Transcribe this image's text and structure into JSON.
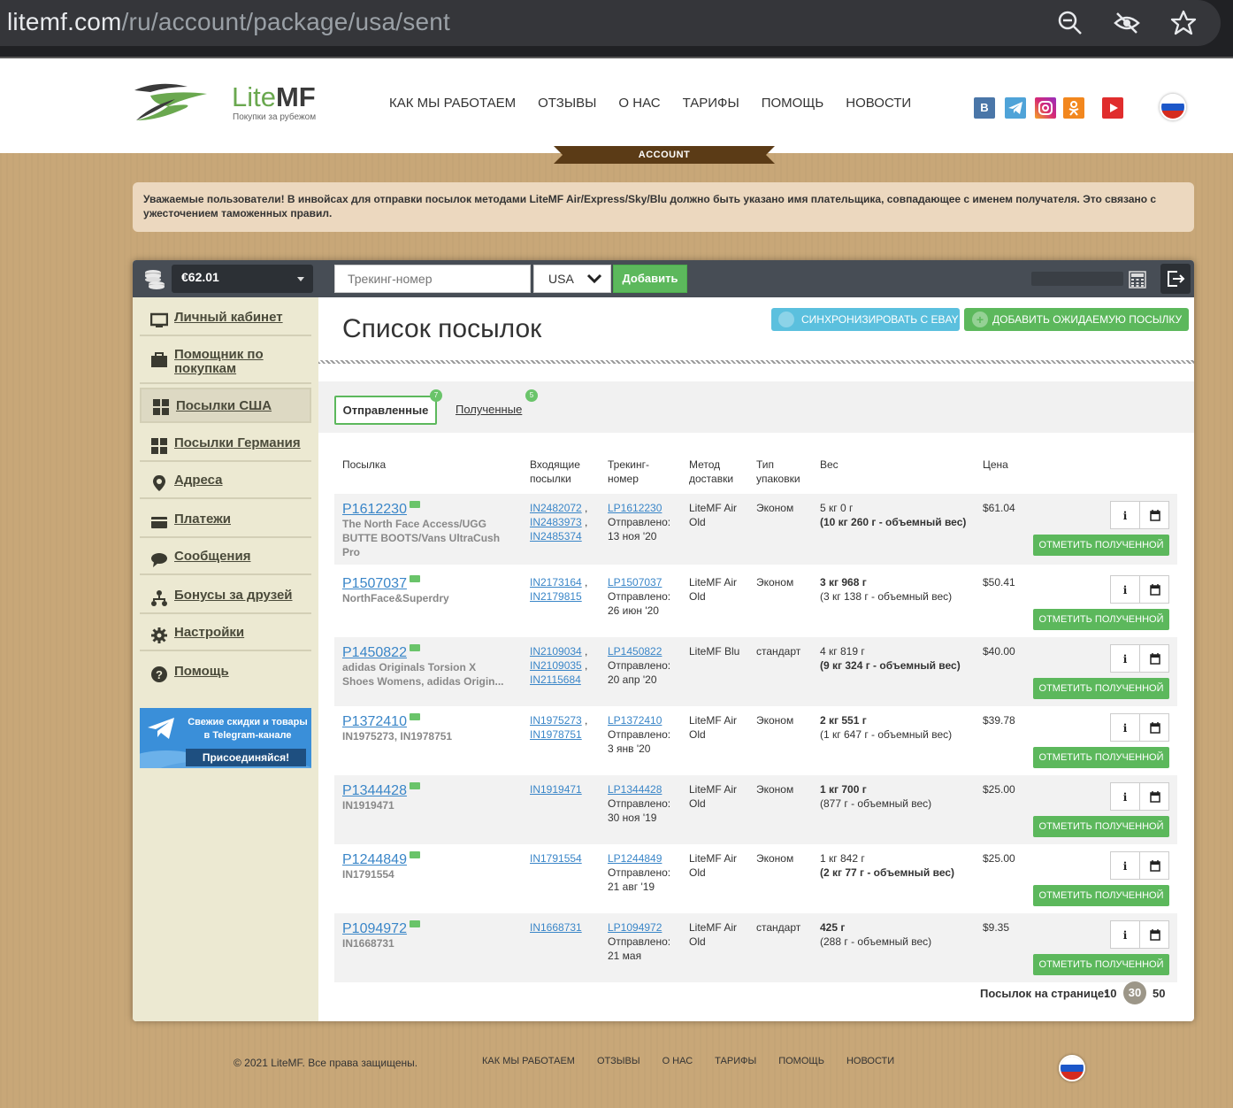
{
  "browser": {
    "url_host": "litemf.com",
    "url_path": "/ru/account/package/usa/sent"
  },
  "header": {
    "logo_lite": "Lite",
    "logo_mf": "MF",
    "logo_subtitle": "Покупки за рубежом",
    "nav": [
      "Как мы работаем",
      "Отзывы",
      "О нас",
      "Тарифы",
      "Помощь",
      "Новости"
    ],
    "social": [
      "vk-icon",
      "telegram-icon",
      "instagram-icon",
      "odnoklassniki-icon",
      "youtube-icon"
    ],
    "account_ribbon": "ACCOUNT"
  },
  "notice": "Уважаемые пользователи! В инвойсах для отправки посылок методами LiteMF Air/Express/Sky/Blu должно быть указано имя плательщика, совпадающее с именем получателя. Это связано с ужесточением таможенных правил.",
  "toolbar": {
    "balance": "€62.01",
    "tracking_placeholder": "Трекинг-номер",
    "country": "USA",
    "add_label": "Добавить"
  },
  "sidebar": {
    "items": [
      {
        "label": "Личный кабинет",
        "icon": "monitor-icon"
      },
      {
        "label": "Помощник по покупкам",
        "icon": "bag-icon"
      },
      {
        "label": "Посылки США",
        "icon": "boxes-icon"
      },
      {
        "label": "Посылки Германия",
        "icon": "boxes-icon"
      },
      {
        "label": "Адреса",
        "icon": "location-pin-icon"
      },
      {
        "label": "Платежи",
        "icon": "wallet-icon"
      },
      {
        "label": "Сообщения",
        "icon": "chat-bubble-icon"
      },
      {
        "label": "Бонусы за друзей",
        "icon": "people-tree-icon"
      },
      {
        "label": "Настройки",
        "icon": "gear-icon"
      },
      {
        "label": "Помощь",
        "icon": "help-icon"
      }
    ],
    "active_index": 2,
    "telegram_banner": {
      "line1": "Свежие скидки и товары в Telegram-канале",
      "cta": "Присоединяйся!"
    }
  },
  "content": {
    "title": "Список посылок",
    "sync_button": "Синхронизировать с eBay",
    "add_expected_button": "Добавить ожидаемую посылку",
    "tabs": [
      {
        "label": "Отправленные",
        "badge": "7"
      },
      {
        "label": "Полученные",
        "badge": "5"
      }
    ],
    "columns": [
      "Посылка",
      "Входящие посылки",
      "Трекинг-номер",
      "Метод доставки",
      "Тип упаковки",
      "Вес",
      "Цена"
    ],
    "rows": [
      {
        "id": "P1612230",
        "desc": "The North Face Access/UGG BUTTE BOOTS/Vans UltraCush Pro",
        "incoming": [
          "IN2482072",
          "IN2483973",
          "IN2485374"
        ],
        "tracking": "LP1612230",
        "sent_label": "Отправлено:",
        "sent_date": "13 ноя '20",
        "method": "LiteMF Air Old",
        "packing": "Эконом",
        "weight": "5 кг 0 г",
        "volume": "(10 кг 260 г - объемный вес)",
        "volume_bold": true,
        "weight_bold": false,
        "price": "$61.04"
      },
      {
        "id": "P1507037",
        "desc": "NorthFace&Superdry",
        "incoming": [
          "IN2173164",
          "IN2179815"
        ],
        "tracking": "LP1507037",
        "sent_label": "Отправлено:",
        "sent_date": "26 июн '20",
        "method": "LiteMF Air Old",
        "packing": "Эконом",
        "weight": "3 кг 968 г",
        "volume": "(3 кг 138 г - объемный вес)",
        "volume_bold": false,
        "weight_bold": true,
        "price": "$50.41"
      },
      {
        "id": "P1450822",
        "desc": "adidas Originals Torsion X Shoes Womens, adidas Origin...",
        "incoming": [
          "IN2109034",
          "IN2109035",
          "IN2115684"
        ],
        "tracking": "LP1450822",
        "sent_label": "Отправлено:",
        "sent_date": "20 апр '20",
        "method": "LiteMF Blu",
        "packing": "стандарт",
        "weight": "4 кг 819 г",
        "volume": "(9 кг 324 г - объемный вес)",
        "volume_bold": true,
        "weight_bold": false,
        "price": "$40.00"
      },
      {
        "id": "P1372410",
        "desc": "IN1975273, IN1978751",
        "incoming": [
          "IN1975273",
          "IN1978751"
        ],
        "tracking": "LP1372410",
        "sent_label": "Отправлено:",
        "sent_date": "3 янв '20",
        "method": "LiteMF Air Old",
        "packing": "Эконом",
        "weight": "2 кг 551 г",
        "volume": "(1 кг 647 г - объемный вес)",
        "volume_bold": false,
        "weight_bold": true,
        "price": "$39.78"
      },
      {
        "id": "P1344428",
        "desc": "IN1919471",
        "incoming": [
          "IN1919471"
        ],
        "tracking": "LP1344428",
        "sent_label": "Отправлено:",
        "sent_date": "30 ноя '19",
        "method": "LiteMF Air Old",
        "packing": "Эконом",
        "weight": "1 кг 700 г",
        "volume": "(877 г - объемный вес)",
        "volume_bold": false,
        "weight_bold": true,
        "price": "$25.00"
      },
      {
        "id": "P1244849",
        "desc": "IN1791554",
        "incoming": [
          "IN1791554"
        ],
        "tracking": "LP1244849",
        "sent_label": "Отправлено:",
        "sent_date": "21 авг '19",
        "method": "LiteMF Air Old",
        "packing": "Эконом",
        "weight": "1 кг 842 г",
        "volume": "(2 кг 77 г - объемный вес)",
        "volume_bold": true,
        "weight_bold": false,
        "price": "$25.00"
      },
      {
        "id": "P1094972",
        "desc": "IN1668731",
        "incoming": [
          "IN1668731"
        ],
        "tracking": "LP1094972",
        "sent_label": "Отправлено:",
        "sent_date": "21 мая",
        "method": "LiteMF Air Old",
        "packing": "стандарт",
        "weight": "425 г",
        "volume": "(288 г - объемный вес)",
        "volume_bold": false,
        "weight_bold": true,
        "price": "$9.35"
      }
    ],
    "mark_received_label": "Отметить полученной",
    "per_page_label": "Посылок на странице:",
    "per_page_options": [
      "10",
      "30",
      "50"
    ],
    "per_page_selected": "30"
  },
  "footer": {
    "copyright": "© 2021 LiteMF. Все права защищены.",
    "nav": [
      "Как мы работаем",
      "Отзывы",
      "О нас",
      "Тарифы",
      "Помощь",
      "Новости"
    ]
  },
  "colors": {
    "accent_green": "#5cb85c",
    "link_blue": "#3a86c8",
    "sync_blue": "#5bc0de",
    "topbar": "#474d55",
    "ribbon_brown": "#5b3b16"
  }
}
